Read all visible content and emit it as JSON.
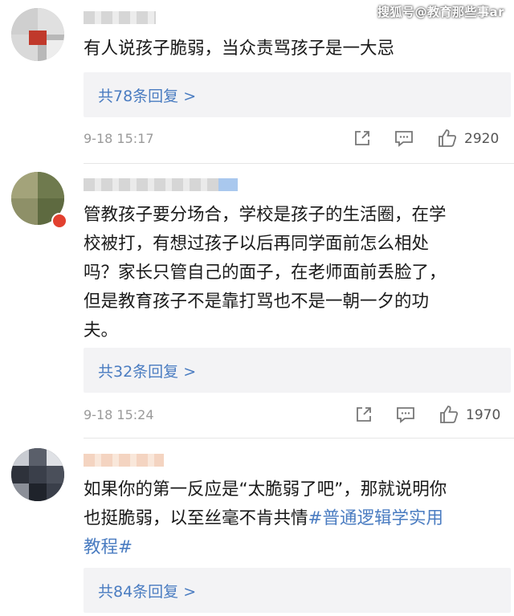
{
  "watermark": "搜狐号@教育那些事ar",
  "comments": [
    {
      "text": "有人说孩子脆弱，当众责骂孩子是一大忌",
      "replies": "共78条回复 >",
      "time": "9-18 15:17",
      "likes": "2920"
    },
    {
      "text_lines": [
        "管教孩子要分场合，学校是孩子的生活圈，在学",
        "校被打，有想过孩子以后再同学面前怎么相处",
        "吗？家长只管自己的面子，在老师面前丢脸了，",
        "但是教育孩子不是靠打骂也不是一朝一夕的功",
        "夫。"
      ],
      "replies": "共32条回复 >",
      "time": "9-18 15:24",
      "likes": "1970"
    },
    {
      "text_lines": [
        "如果你的第一反应是“太脆弱了吧”，那就说明你",
        "也挺脆弱，以至丝毫不肯共情"
      ],
      "hashtag_line1": "#普通逻辑学实用",
      "hashtag_line2": "教程#",
      "replies": "共84条回复 >"
    }
  ],
  "icons": {
    "share": "share-icon",
    "comment": "comment-icon",
    "like": "thumbs-up-icon"
  },
  "colors": {
    "link": "#4a7cc1",
    "reply_bg": "#f3f3f5",
    "meta_text": "#9a9a9a"
  }
}
